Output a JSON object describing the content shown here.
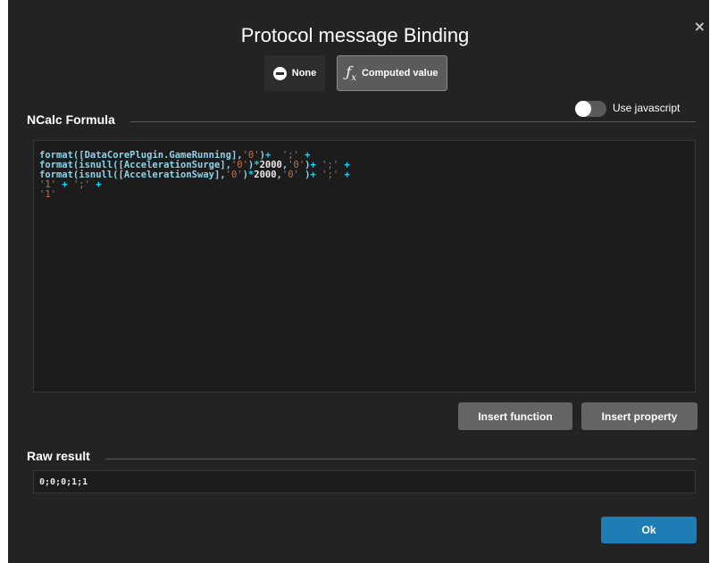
{
  "dialog": {
    "title": "Protocol message Binding",
    "close_label": "×"
  },
  "mode_buttons": {
    "none_label": "None",
    "computed_label": "Computed value",
    "selected": "Computed value"
  },
  "formula_section": {
    "label": "NCalc Formula",
    "use_javascript_label": "Use javascript",
    "use_javascript_enabled": false,
    "lines": [
      [
        {
          "t": "format(",
          "c": "fn"
        },
        {
          "t": "[DataCorePlugin.GameRunning]",
          "c": "fn"
        },
        {
          "t": ",",
          "c": "fn"
        },
        {
          "t": "'0'",
          "c": "str"
        },
        {
          "t": ")",
          "c": "fn"
        },
        {
          "t": "+  ",
          "c": "op"
        },
        {
          "t": "';'",
          "c": "str"
        },
        {
          "t": " +",
          "c": "op"
        }
      ],
      [
        {
          "t": "format(isnull([AccelerationSurge],",
          "c": "fn"
        },
        {
          "t": "'0'",
          "c": "str"
        },
        {
          "t": ")",
          "c": "fn"
        },
        {
          "t": "*",
          "c": "op"
        },
        {
          "t": "2000",
          "c": "num"
        },
        {
          "t": ",",
          "c": "fn"
        },
        {
          "t": "'0'",
          "c": "str"
        },
        {
          "t": ")",
          "c": "fn"
        },
        {
          "t": "+ ",
          "c": "op"
        },
        {
          "t": "';'",
          "c": "str"
        },
        {
          "t": " +",
          "c": "op"
        }
      ],
      [
        {
          "t": "format(isnull([AccelerationSway]",
          "c": "fn"
        },
        {
          "t": ",",
          "c": "fn"
        },
        {
          "t": "'0'",
          "c": "str"
        },
        {
          "t": ")",
          "c": "fn"
        },
        {
          "t": "*",
          "c": "op"
        },
        {
          "t": "2000",
          "c": "num"
        },
        {
          "t": ",",
          "c": "fn"
        },
        {
          "t": "'0'",
          "c": "str"
        },
        {
          "t": " )",
          "c": "fn"
        },
        {
          "t": "+ ",
          "c": "op"
        },
        {
          "t": "';'",
          "c": "str"
        },
        {
          "t": " +",
          "c": "op"
        }
      ],
      [
        {
          "t": "'1'",
          "c": "str"
        },
        {
          "t": " + ",
          "c": "op"
        },
        {
          "t": "';'",
          "c": "str"
        },
        {
          "t": " +",
          "c": "op"
        }
      ],
      [
        {
          "t": "'1'",
          "c": "str"
        }
      ]
    ]
  },
  "actions": {
    "insert_function": "Insert function",
    "insert_property": "Insert property"
  },
  "raw_result": {
    "label": "Raw result",
    "value": "0;0;0;1;1"
  },
  "footer": {
    "ok_label": "Ok"
  },
  "colors": {
    "dialog_bg": "#232323",
    "editor_bg": "#1c1c1c",
    "accent": "#1e7db5",
    "token_function": "#8fd3e8",
    "token_string": "#c0714d",
    "token_operator": "#00e0ff"
  }
}
